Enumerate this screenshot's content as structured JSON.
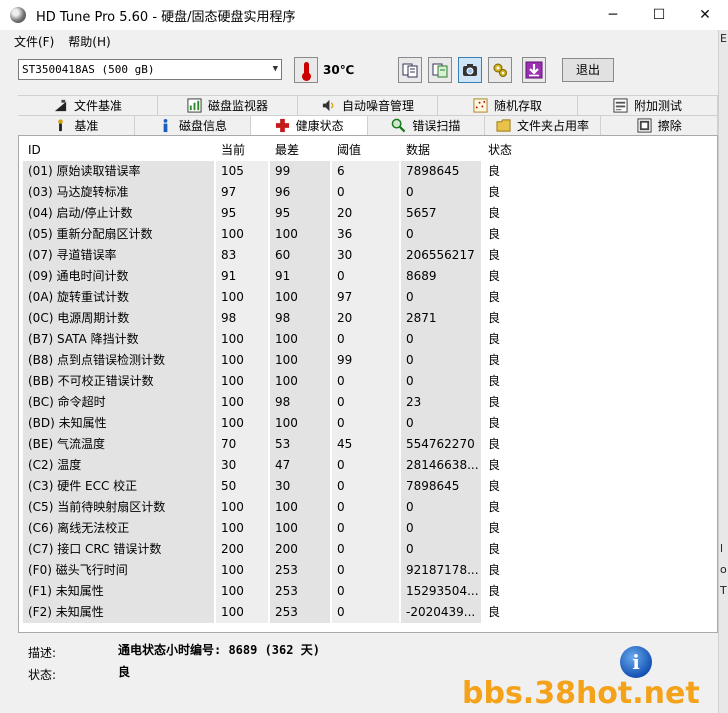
{
  "window": {
    "title": "HD Tune Pro 5.60 - 硬盘/固态硬盘实用程序",
    "minimize": "─",
    "maximize": "☐",
    "close": "✕"
  },
  "menu": [
    {
      "label": "文件(F)"
    },
    {
      "label": "帮助(H)"
    }
  ],
  "toolbar": {
    "drive": "ST3500418AS (500 gB)",
    "temperature": "30℃",
    "exit_label": "退出",
    "tools": [
      "copy-info-icon",
      "copy-screen-icon",
      "screenshot-icon",
      "options-icon",
      "save-icon"
    ]
  },
  "tabs_top": [
    {
      "label": "文件基准",
      "icon": "file-benchmark-icon"
    },
    {
      "label": "磁盘监视器",
      "icon": "disk-monitor-icon"
    },
    {
      "label": "自动噪音管理",
      "icon": "speaker-icon"
    },
    {
      "label": "随机存取",
      "icon": "random-access-icon"
    },
    {
      "label": "附加测试",
      "icon": "extra-tests-icon"
    }
  ],
  "tabs_bottom": [
    {
      "label": "基准",
      "icon": "benchmark-icon"
    },
    {
      "label": "磁盘信息",
      "icon": "info-icon"
    },
    {
      "label": "健康状态",
      "icon": "health-cross-icon",
      "active": true
    },
    {
      "label": "错误扫描",
      "icon": "search-icon"
    },
    {
      "label": "文件夹占用率",
      "icon": "folder-icon"
    },
    {
      "label": "擦除",
      "icon": "erase-icon"
    }
  ],
  "table": {
    "headers": [
      "ID",
      "当前",
      "最差",
      "阈值",
      "数据",
      "状态"
    ],
    "rows": [
      [
        "(01) 原始读取错误率",
        "105",
        "99",
        "6",
        "7898645",
        "良"
      ],
      [
        "(03) 马达旋转标准",
        "97",
        "96",
        "0",
        "0",
        "良"
      ],
      [
        "(04) 启动/停止计数",
        "95",
        "95",
        "20",
        "5657",
        "良"
      ],
      [
        "(05) 重新分配扇区计数",
        "100",
        "100",
        "36",
        "0",
        "良"
      ],
      [
        "(07) 寻道错误率",
        "83",
        "60",
        "30",
        "206556217",
        "良"
      ],
      [
        "(09) 通电时间计数",
        "91",
        "91",
        "0",
        "8689",
        "良"
      ],
      [
        "(0A) 旋转重试计数",
        "100",
        "100",
        "97",
        "0",
        "良"
      ],
      [
        "(0C) 电源周期计数",
        "98",
        "98",
        "20",
        "2871",
        "良"
      ],
      [
        "(B7) SATA 降挡计数",
        "100",
        "100",
        "0",
        "0",
        "良"
      ],
      [
        "(B8) 点到点错误检测计数",
        "100",
        "100",
        "99",
        "0",
        "良"
      ],
      [
        "(BB) 不可校正错误计数",
        "100",
        "100",
        "0",
        "0",
        "良"
      ],
      [
        "(BC) 命令超时",
        "100",
        "98",
        "0",
        "23",
        "良"
      ],
      [
        "(BD) 未知属性",
        "100",
        "100",
        "0",
        "0",
        "良"
      ],
      [
        "(BE) 气流温度",
        "70",
        "53",
        "45",
        "554762270",
        "良"
      ],
      [
        "(C2) 温度",
        "30",
        "47",
        "0",
        "28146638...",
        "良"
      ],
      [
        "(C3) 硬件 ECC 校正",
        "50",
        "30",
        "0",
        "7898645",
        "良"
      ],
      [
        "(C5) 当前待映射扇区计数",
        "100",
        "100",
        "0",
        "0",
        "良"
      ],
      [
        "(C6) 离线无法校正",
        "100",
        "100",
        "0",
        "0",
        "良"
      ],
      [
        "(C7) 接口 CRC 错误计数",
        "200",
        "200",
        "0",
        "0",
        "良"
      ],
      [
        "(F0) 磁头飞行时间",
        "100",
        "253",
        "0",
        "92187178...",
        "良"
      ],
      [
        "(F1) 未知属性",
        "100",
        "253",
        "0",
        "15293504...",
        "良"
      ],
      [
        "(F2) 未知属性",
        "100",
        "253",
        "0",
        "-2020439...",
        "良"
      ]
    ]
  },
  "footer": {
    "desc_label": "描述:",
    "desc_value": "通电状态小时编号: 8689 (362 天)",
    "status_label": "状态:",
    "status_value": "良"
  },
  "info_glyph": "i",
  "watermark": "bbs.38hot.net",
  "right_edge_glyphs": [
    "E",
    "l",
    "o",
    "T"
  ]
}
